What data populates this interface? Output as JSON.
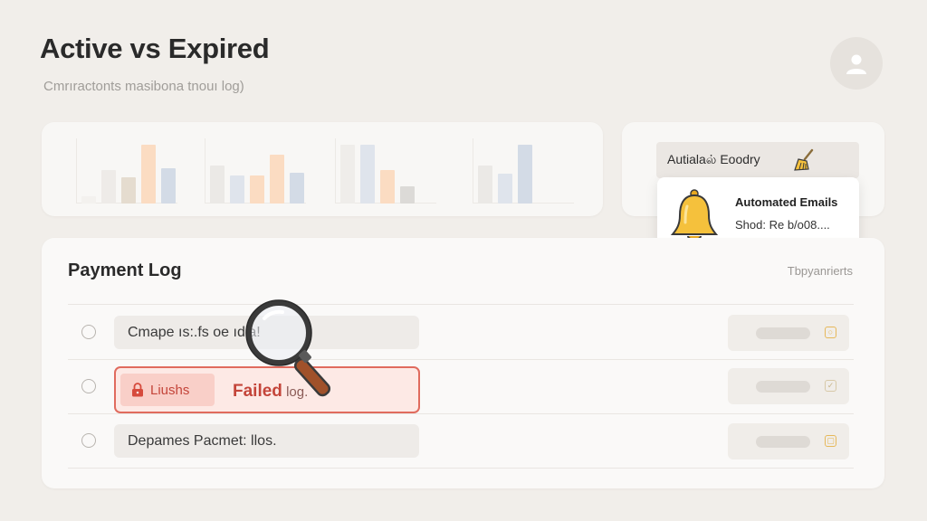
{
  "header": {
    "title": "Active vs Expired",
    "subtitle": "Cmrıractonts masibona tnouı log)"
  },
  "charts": [
    {
      "bars": [
        {
          "value": 0.12,
          "color": "#f3f1ee"
        },
        {
          "value": 0.55,
          "color": "#eeebe8"
        },
        {
          "value": 0.42,
          "color": "#e5dccf"
        },
        {
          "value": 0.95,
          "color": "#fbdcc2"
        },
        {
          "value": 0.58,
          "color": "#d3dbe6"
        }
      ]
    },
    {
      "bars": [
        {
          "value": 0.62,
          "color": "#ebe9e6"
        },
        {
          "value": 0.45,
          "color": "#dfe4ec"
        },
        {
          "value": 0.45,
          "color": "#fbdcc2"
        },
        {
          "value": 0.8,
          "color": "#fbdcc2"
        },
        {
          "value": 0.5,
          "color": "#d3dbe6"
        }
      ]
    },
    {
      "bars": [
        {
          "value": 0.95,
          "color": "#efedea"
        },
        {
          "value": 0.95,
          "color": "#dfe4ec"
        },
        {
          "value": 0.55,
          "color": "#fbdcc2"
        },
        {
          "value": 0.28,
          "color": "#dcdad7"
        }
      ]
    },
    {
      "bars": [
        {
          "value": 0.62,
          "color": "#ebe9e6"
        },
        {
          "value": 0.48,
          "color": "#dfe4ec"
        },
        {
          "value": 0.95,
          "color": "#d3dbe6"
        }
      ]
    }
  ],
  "side_panel": {
    "dropdown_label": "Autialaல் Eoodry",
    "notification": {
      "title": "Automated Emails",
      "subtitle": "Shod: Re b/o08...."
    }
  },
  "payment_log": {
    "title": "Payment Log",
    "meta": "Tbpyanrierts",
    "rows": [
      {
        "label": "Cmape ıs:.fs oe ıdla!",
        "status": "normal"
      },
      {
        "chip": "Liushs",
        "label": "Failed",
        "label_tail": " log.",
        "status": "failed"
      },
      {
        "label": "Depames Pacmet: llos.",
        "status": "normal"
      }
    ]
  },
  "colors": {
    "accent_orange": "#fbdcc2",
    "accent_blue": "#d3dbe6",
    "error_red": "#c4453a",
    "error_border": "#e06b5e",
    "bell_yellow": "#f5c13c"
  },
  "icons": [
    "user-icon",
    "broom-icon",
    "bell-icon",
    "lock-icon",
    "magnifier-icon",
    "radio-icon"
  ]
}
